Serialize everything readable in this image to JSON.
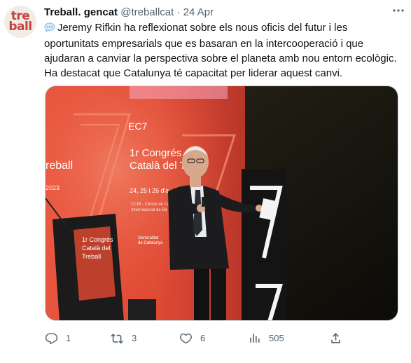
{
  "avatar": {
    "line1": "tre",
    "line2": "ball"
  },
  "tweet": {
    "author_name": "Treball. gencat",
    "handle": "@treballcat",
    "separator": "·",
    "date": "24 Apr",
    "text": "Jeremy Rifkin ha reflexionat sobre els nous oficis del futur i les oportunitats empresarials que es basaran en la intercooperació i que ajudaran a canviar la perspectiva sobre el planeta amb nou entorn ecològic. Ha destacat que Catalunya té capacitat per liderar aquest canvi."
  },
  "media": {
    "banner_left_line1": "reball",
    "banner_left_line2": "2023",
    "banner_logo": "EC7",
    "banner_title_line1": "1r Congrés",
    "banner_title_line2": "Català del Treb",
    "banner_dates": "24, 25 i 26 d'a",
    "banner_sub1": "CCIB - Centre de Co",
    "banner_sub2": "Internacional de Ba",
    "banner_gencat1": "Generalitat",
    "banner_gencat2": "de Catalunya",
    "podium_line1": "1r Congrés",
    "podium_line2": "Català del",
    "podium_line3": "Treball"
  },
  "actions": {
    "reply_count": "1",
    "retweet_count": "3",
    "like_count": "6",
    "views_count": "505"
  },
  "colors": {
    "accent_text": "#536471",
    "brand_red": "#c8423a"
  }
}
